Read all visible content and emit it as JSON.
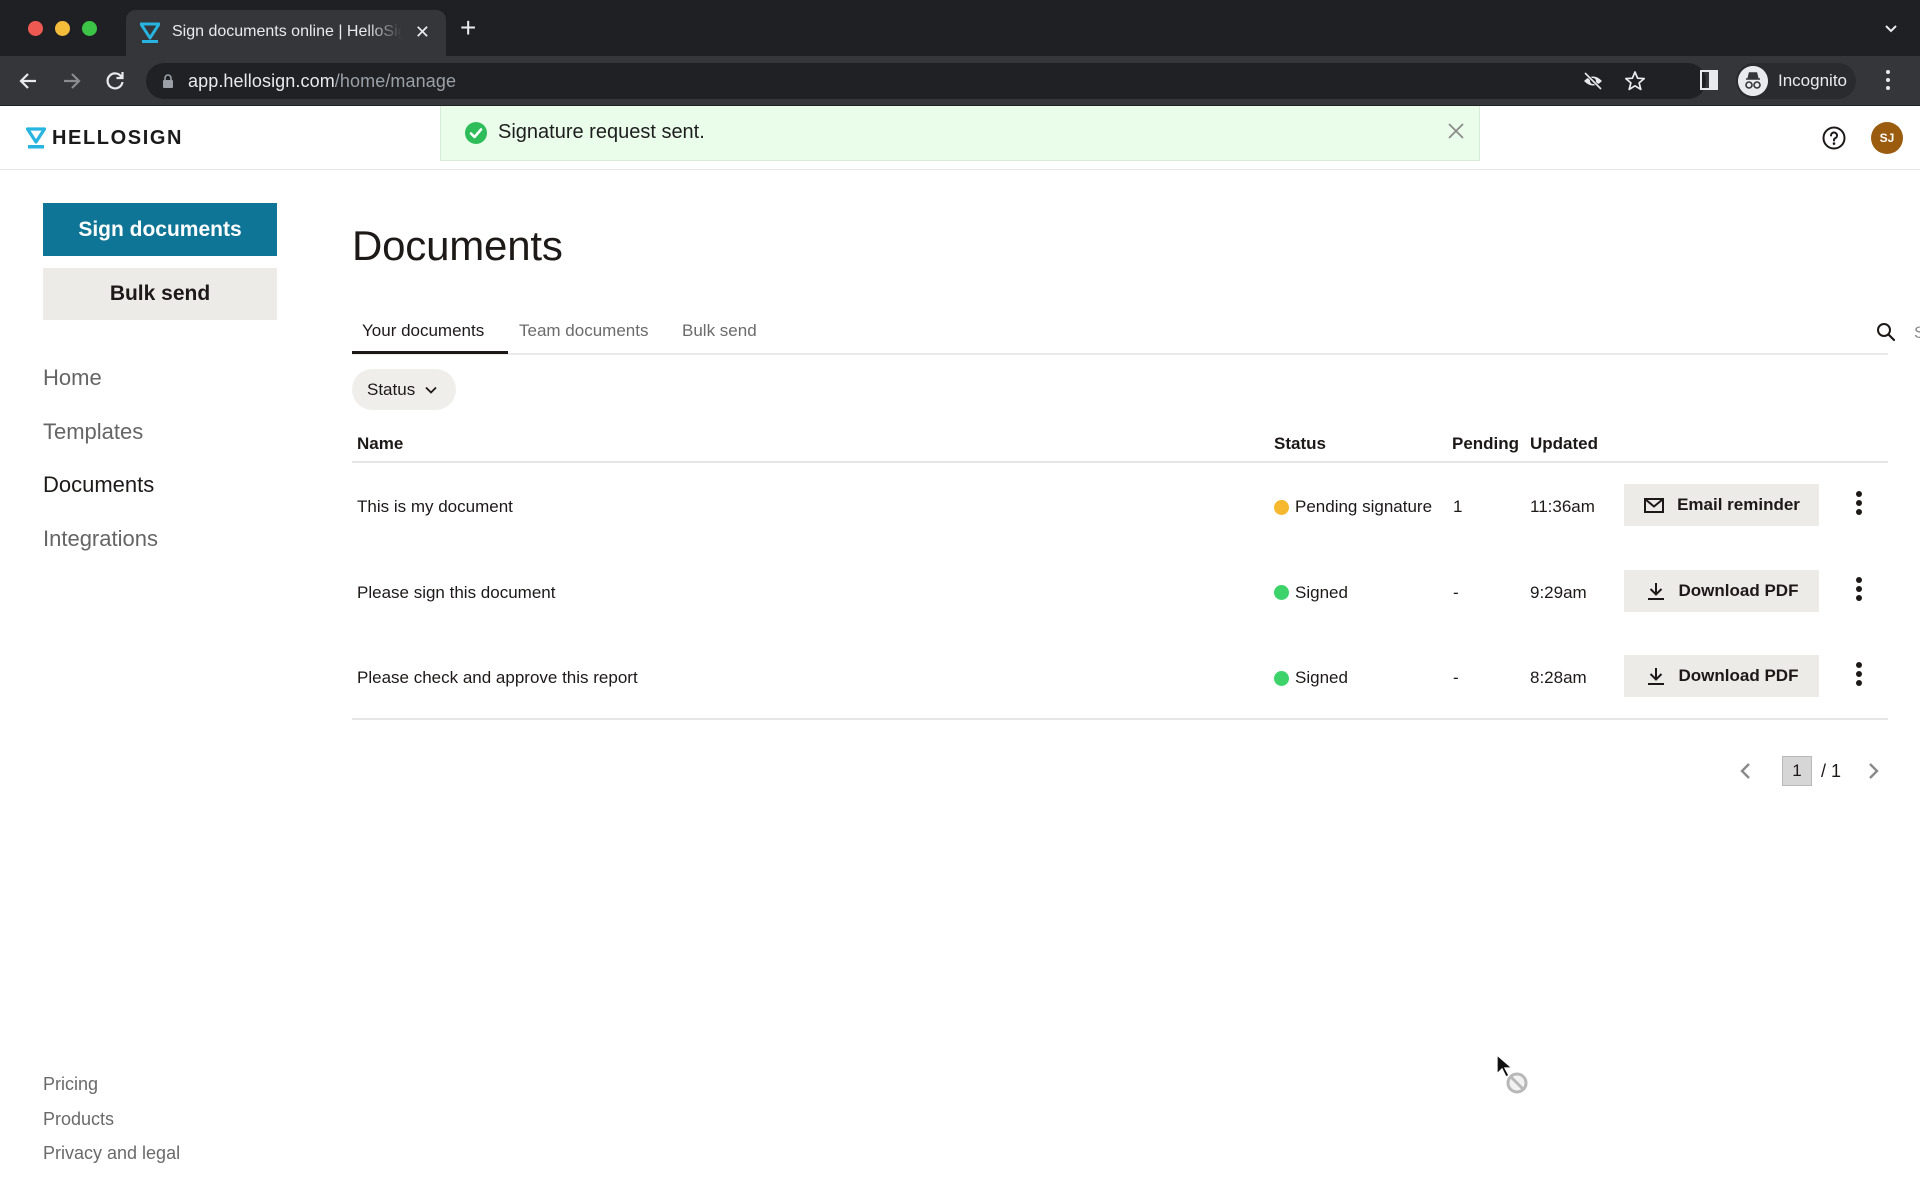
{
  "browser": {
    "tab_title": "Sign documents online | HelloSign",
    "url_host": "app.hellosign.com",
    "url_path": "/home/manage",
    "profile_label": "Incognito",
    "icons": [
      "back-icon",
      "forward-icon",
      "reload-icon",
      "lock-icon",
      "eye-off-icon",
      "star-icon",
      "side-panel-icon",
      "incognito-icon",
      "menu-icon"
    ]
  },
  "header": {
    "logo_text": "HELLOSIGN",
    "toast_message": "Signature request sent.",
    "avatar_initials": "SJ",
    "colors": {
      "brand": "#0f7596",
      "toast_bg": "#eafcea",
      "avatar": "#9b5c10"
    }
  },
  "sidebar": {
    "primary_button": "Sign documents",
    "secondary_button": "Bulk send",
    "nav": [
      {
        "label": "Home",
        "active": false
      },
      {
        "label": "Templates",
        "active": false
      },
      {
        "label": "Documents",
        "active": true
      },
      {
        "label": "Integrations",
        "active": false
      }
    ],
    "footer": [
      {
        "label": "Pricing"
      },
      {
        "label": "Products"
      },
      {
        "label": "Privacy and legal"
      }
    ]
  },
  "main": {
    "title": "Documents",
    "tabs": [
      {
        "label": "Your documents",
        "active": true
      },
      {
        "label": "Team documents",
        "active": false
      },
      {
        "label": "Bulk send",
        "active": false
      }
    ],
    "search_placeholder": "Search by name, email or keyword",
    "search_value": "",
    "filter_label": "Status",
    "table": {
      "columns": [
        "Name",
        "Status",
        "Pending",
        "Updated"
      ],
      "rows": [
        {
          "name": "This is my document",
          "status": "Pending signature",
          "status_color": "#f5b82e",
          "pending": "1",
          "updated": "11:36am",
          "action": "Email reminder",
          "action_icon": "mail-icon"
        },
        {
          "name": "Please sign this document",
          "status": "Signed",
          "status_color": "#3ed26b",
          "pending": "-",
          "updated": "9:29am",
          "action": "Download PDF",
          "action_icon": "download-icon"
        },
        {
          "name": "Please check and approve this report",
          "status": "Signed",
          "status_color": "#3ed26b",
          "pending": "-",
          "updated": "8:28am",
          "action": "Download PDF",
          "action_icon": "download-icon"
        }
      ]
    },
    "pagination": {
      "current": "1",
      "total": "/ 1"
    }
  }
}
